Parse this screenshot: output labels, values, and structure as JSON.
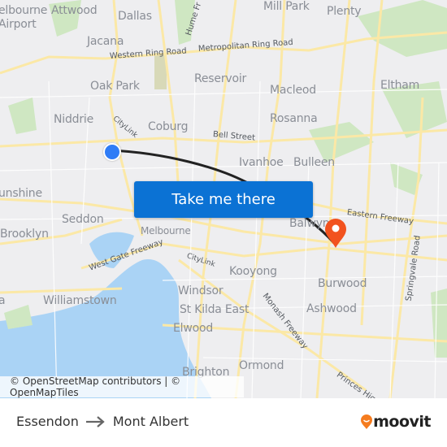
{
  "map": {
    "places": [
      {
        "name": "Melbourne Airport",
        "text": "elbourne"
      },
      {
        "name": "airport-line2",
        "text": "Airport"
      },
      {
        "name": "Attwood",
        "text": "Attwood"
      },
      {
        "name": "Dallas",
        "text": "Dallas"
      },
      {
        "name": "Mill Park",
        "text": "Mill Park"
      },
      {
        "name": "Plenty",
        "text": "Plenty"
      },
      {
        "name": "Jacana",
        "text": "Jacana"
      },
      {
        "name": "Oak Park",
        "text": "Oak Park"
      },
      {
        "name": "Reservoir",
        "text": "Reservoir"
      },
      {
        "name": "Macleod",
        "text": "Macleod"
      },
      {
        "name": "Eltham",
        "text": "Eltham"
      },
      {
        "name": "Niddrie",
        "text": "Niddrie"
      },
      {
        "name": "Coburg",
        "text": "Coburg"
      },
      {
        "name": "Rosanna",
        "text": "Rosanna"
      },
      {
        "name": "Ivanhoe",
        "text": "Ivanhoe"
      },
      {
        "name": "Bulleen",
        "text": "Bulleen"
      },
      {
        "name": "Sunshine",
        "text": "unshine"
      },
      {
        "name": "Seddon",
        "text": "Seddon"
      },
      {
        "name": "Brooklyn",
        "text": "Brooklyn"
      },
      {
        "name": "Melbourne",
        "text": "Melbourne"
      },
      {
        "name": "Balwyn",
        "text": "Balwyn"
      },
      {
        "name": "Kooyong",
        "text": "Kooyong"
      },
      {
        "name": "Burwood",
        "text": "Burwood"
      },
      {
        "name": "Windsor",
        "text": "Windsor"
      },
      {
        "name": "Williamstown",
        "text": "Williamstown"
      },
      {
        "name": "St Kilda East",
        "text": "St Kilda East"
      },
      {
        "name": "Ashwood",
        "text": "Ashwood"
      },
      {
        "name": "Elwood",
        "text": "Elwood"
      },
      {
        "name": "Ormond",
        "text": "Ormond"
      },
      {
        "name": "Brighton",
        "text": "Brighton"
      },
      {
        "name": "Altona",
        "text": "a"
      }
    ],
    "roads": [
      {
        "name": "Western Ring Road",
        "text": "Western Ring Road"
      },
      {
        "name": "Metropolitan Ring Road",
        "text": "Metropolitan Ring Road"
      },
      {
        "name": "Hume Freeway",
        "text": "Hume Fr"
      },
      {
        "name": "CityLink north",
        "text": "CityLink"
      },
      {
        "name": "Bell Street",
        "text": "Bell Street"
      },
      {
        "name": "Eastern Freeway",
        "text": "Eastern Freeway"
      },
      {
        "name": "West Gate Freeway",
        "text": "West Gate Freeway"
      },
      {
        "name": "CityLink south",
        "text": "CityLink"
      },
      {
        "name": "Monash Freeway",
        "text": "Monash Freeway"
      },
      {
        "name": "Springvale Road",
        "text": "Springvale Road"
      },
      {
        "name": "Princes Highway",
        "text": "Princes Hig"
      }
    ],
    "attribution": "© OpenStreetMap contributors | © OpenMapTiles",
    "cta_label": "Take me there",
    "colors": {
      "cta": "#0b72d4",
      "origin": "#2f7cf6",
      "destination": "#f2521e",
      "route": "#222222",
      "water": "#aad3f5"
    }
  },
  "footer": {
    "origin": "Essendon",
    "destination": "Mont Albert",
    "brand": "moovit",
    "brand_color": "#f57c1f"
  }
}
